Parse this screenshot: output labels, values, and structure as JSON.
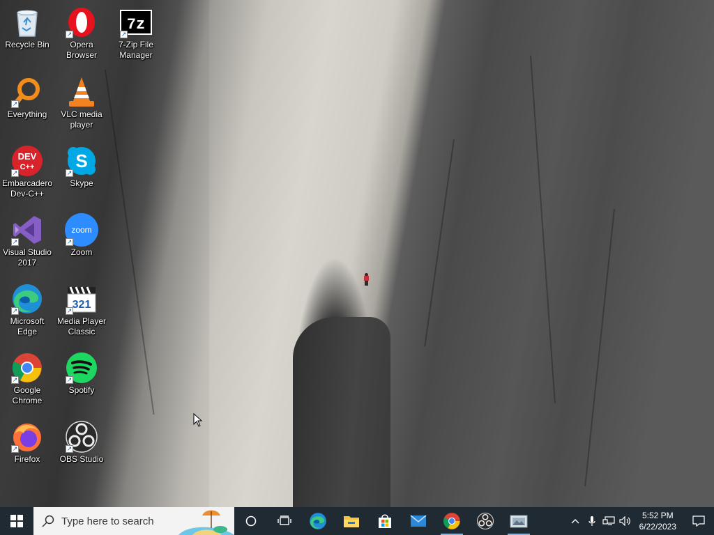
{
  "desktop": {
    "icons": [
      {
        "id": "recycle-bin",
        "label": "Recycle Bin"
      },
      {
        "id": "opera",
        "label": "Opera\nBrowser"
      },
      {
        "id": "seven-zip",
        "label": "7-Zip File\nManager"
      },
      {
        "id": "everything",
        "label": "Everything"
      },
      {
        "id": "vlc",
        "label": "VLC media\nplayer"
      },
      {
        "id": "devcpp",
        "label": "Embarcadero\nDev-C++"
      },
      {
        "id": "skype",
        "label": "Skype"
      },
      {
        "id": "visual-studio",
        "label": "Visual Studio\n2017"
      },
      {
        "id": "zoom",
        "label": "Zoom"
      },
      {
        "id": "edge",
        "label": "Microsoft\nEdge"
      },
      {
        "id": "mpc",
        "label": "Media Player\nClassic"
      },
      {
        "id": "chrome",
        "label": "Google\nChrome"
      },
      {
        "id": "spotify",
        "label": "Spotify"
      },
      {
        "id": "firefox",
        "label": "Firefox"
      },
      {
        "id": "obs",
        "label": "OBS Studio"
      }
    ],
    "icon_glyphs": {
      "seven_zip": "7z",
      "devcpp_top": "DEV",
      "devcpp_bottom": "C++",
      "skype": "S",
      "zoom": "zoom",
      "mpc": "321"
    }
  },
  "taskbar": {
    "search_placeholder": "Type here to search",
    "pinned": [
      {
        "id": "cortana",
        "icon": "circle-icon"
      },
      {
        "id": "task-view",
        "icon": "task-view-icon"
      },
      {
        "id": "edge",
        "icon": "edge-icon"
      },
      {
        "id": "file-explorer",
        "icon": "folder-icon"
      },
      {
        "id": "store",
        "icon": "store-icon"
      },
      {
        "id": "mail",
        "icon": "mail-icon"
      },
      {
        "id": "chrome",
        "icon": "chrome-icon"
      },
      {
        "id": "obs",
        "icon": "obs-icon"
      },
      {
        "id": "photos",
        "icon": "photos-icon"
      }
    ],
    "clock": {
      "time": "5:52 PM",
      "date": "6/22/2023"
    },
    "tray_chevron": "^"
  },
  "colors": {
    "taskbar": "#1f2a33",
    "running_indicator": "#8ab4d8"
  }
}
